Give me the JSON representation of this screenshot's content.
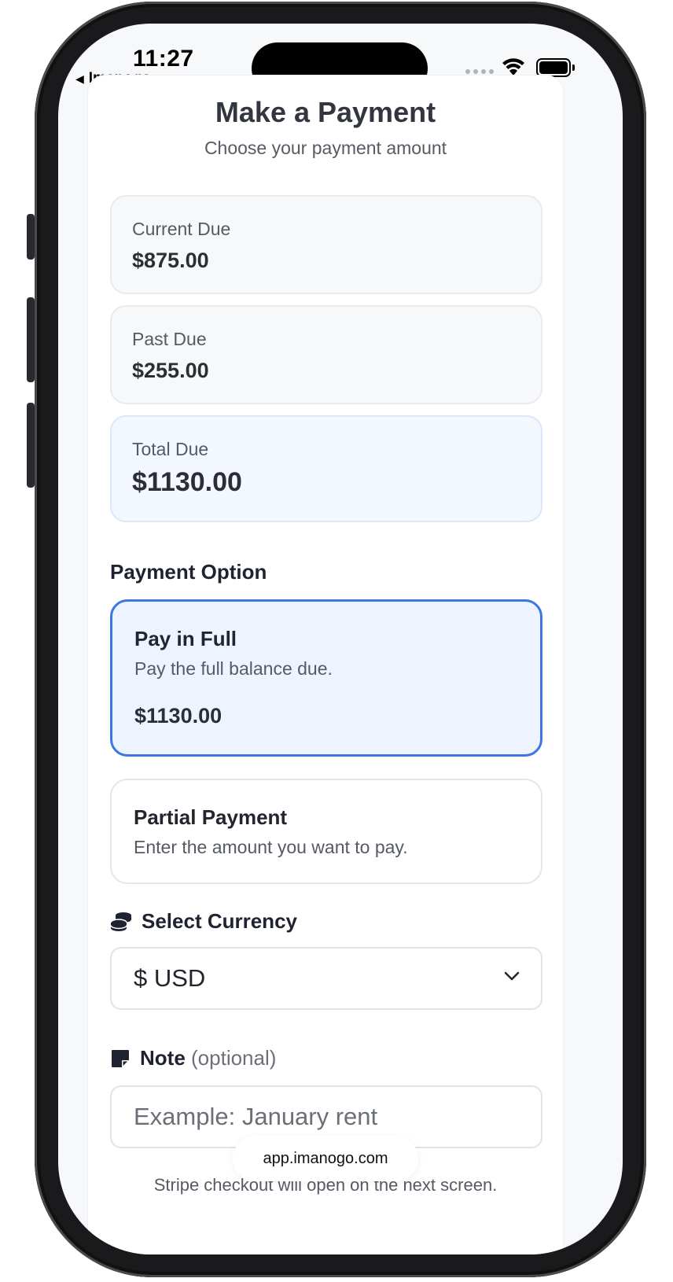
{
  "status_bar": {
    "time": "11:27",
    "back_app": "Imanogo"
  },
  "header": {
    "title": "Make a Payment",
    "subtitle": "Choose your payment amount"
  },
  "balances": [
    {
      "label": "Current Due",
      "amount": "$875.00"
    },
    {
      "label": "Past Due",
      "amount": "$255.00"
    },
    {
      "label": "Total Due",
      "amount": "$1130.00"
    }
  ],
  "payment_option": {
    "label": "Payment Option",
    "options": [
      {
        "title": "Pay in Full",
        "description": "Pay the full balance due.",
        "amount": "$1130.00",
        "selected": true
      },
      {
        "title": "Partial Payment",
        "description": "Enter the amount you want to pay.",
        "selected": false
      }
    ]
  },
  "currency": {
    "label": "Select Currency",
    "selected": "$ USD",
    "icon": "coins-icon"
  },
  "note": {
    "label": "Note",
    "optional": "(optional)",
    "placeholder": "Example: January rent",
    "icon": "sticky-note-icon"
  },
  "footnote": "Stripe checkout will open on the next screen.",
  "browser": {
    "url": "app.imanogo.com"
  },
  "colors": {
    "accent": "#3b76e1",
    "selected_bg": "#eef4ff"
  }
}
